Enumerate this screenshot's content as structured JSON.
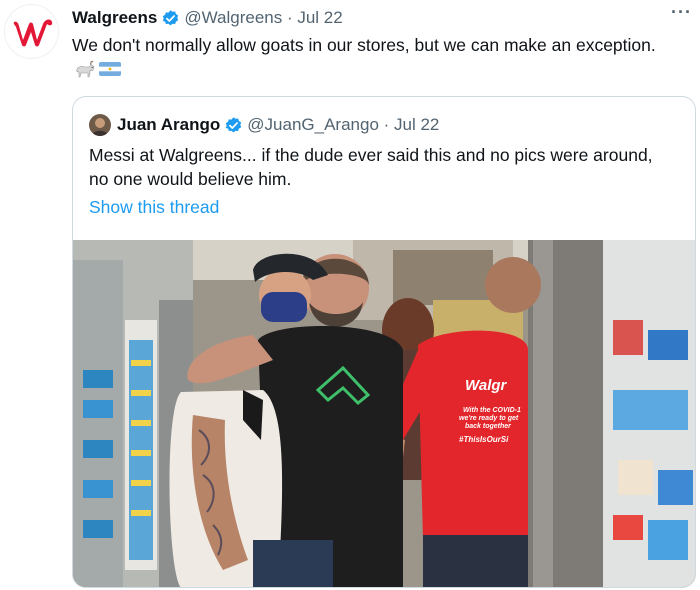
{
  "tweet": {
    "author_name": "Walgreens",
    "handle": "@Walgreens",
    "separator": " · ",
    "date": "Jul 22",
    "text": "We don't normally allow goats in our stores, but we can make an exception.",
    "emojis": [
      "goat-emoji",
      "argentina-flag-emoji"
    ],
    "more_label": "···"
  },
  "quoted_tweet": {
    "author_name": "Juan Arango",
    "handle": "@JuanG_Arango",
    "separator": " · ",
    "date": "Jul 22",
    "text_line1": "Messi at Walgreens... if the dude ever said this and no pics were around,",
    "text_line2": "no one would believe him.",
    "show_thread_label": "Show this thread",
    "photo": {
      "shirt_lines": [
        "Walgr",
        "With the COVID-1",
        "we're ready to get",
        "back together",
        "#ThisIsOurSi"
      ]
    }
  },
  "colors": {
    "brand_red": "#e31837",
    "verified_blue": "#1d9bf0",
    "link_blue": "#1d9bf0",
    "secondary_text": "#536471"
  }
}
